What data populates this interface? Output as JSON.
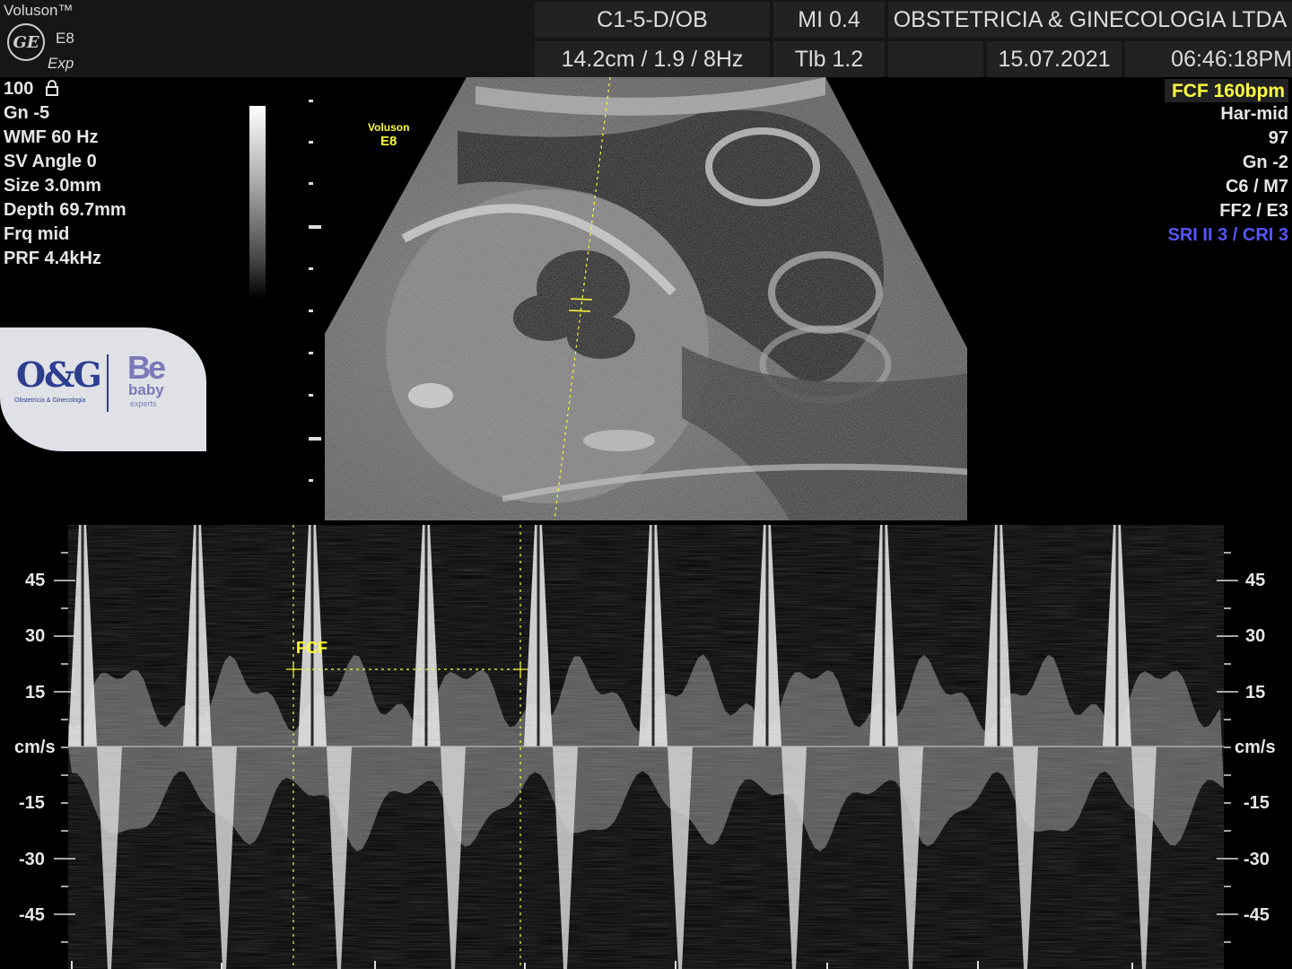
{
  "header": {
    "brand": {
      "title": "Voluson™",
      "logo": "GE",
      "model": "E8",
      "sub": "Exp"
    },
    "probe": "C1-5-D/OB",
    "mi": "MI  0.4",
    "institution": "OBSTETRICIA & GINECOLOGIA LTDA",
    "depth_info": "14.2cm / 1.9 /  8Hz",
    "tib": "Tlb  1.2",
    "date": "15.07.2021",
    "time": "06:46:18PM"
  },
  "left_params": [
    "100",
    "Gn  -5",
    "WMF 60 Hz",
    "SV Angle  0",
    "Size  3.0mm",
    "Depth 69.7mm",
    "Frq mid",
    "PRF  4.4kHz"
  ],
  "lock_icon": "lock-icon",
  "right_params": {
    "fcf": "FCF 160bpm",
    "items": [
      "Har-mid",
      "97",
      "Gn  -2",
      "C6 / M7",
      "FF2 / E3"
    ],
    "sri": "SRI II 3 / CRI 3"
  },
  "bmode_watermark": {
    "line1": "Voluson",
    "line2": "E8"
  },
  "clinic_logo": {
    "mark": "O&G",
    "sub": "Obstetrícia & Ginecologia",
    "partner_mark": "Be",
    "partner_line1": "baby",
    "partner_line2": "experts"
  },
  "doppler": {
    "unit": "cm/s",
    "scale_left": [
      "45",
      "30",
      "15",
      "-15",
      "-30",
      "-45"
    ],
    "scale_right": [
      "45",
      "30",
      "15",
      "-15",
      "-30",
      "-45"
    ],
    "measure_label": "FCF"
  },
  "colors": {
    "fcf_highlight": "#ffff40",
    "sri_blue": "#5555ff",
    "caliper_yellow": "#ffff30"
  }
}
